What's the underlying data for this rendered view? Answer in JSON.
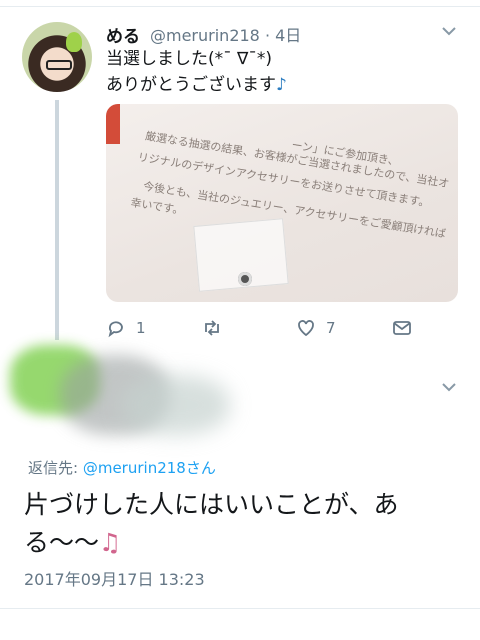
{
  "tweet1": {
    "display_name": "める",
    "handle_time": "@merurin218 · 4日",
    "line1": "当選しました(*¯ ∇¯*)",
    "line2": "ありがとうございます",
    "line2_emoji": "♪",
    "media_lines": [
      "厳選なる抽選の結果、お客様がご当選されましたので、当社オ",
      "リジナルのデザインアクセサリーをお送りさせて頂きます。",
      "今後とも、当社のジュエリー、アクセサリーをご愛顧頂ければ",
      "幸いです。"
    ],
    "media_top_fragment": "ーン」にご参加頂き、",
    "reply_count": "1",
    "like_count": "7"
  },
  "tweet2": {
    "reply_prefix": "返信先:",
    "reply_handle": "@merurin218さん",
    "text": "片づけした人にはいいことが、ある〜〜",
    "emoji": "♫",
    "timestamp": "2017年09月17日 13:23"
  },
  "icons": {
    "reply": "reply-icon",
    "retweet": "retweet-icon",
    "like": "heart-icon",
    "dm": "message-icon",
    "caret": "chevron-down-icon"
  },
  "colors": {
    "link": "#1da1f2",
    "secondary": "#657786"
  }
}
